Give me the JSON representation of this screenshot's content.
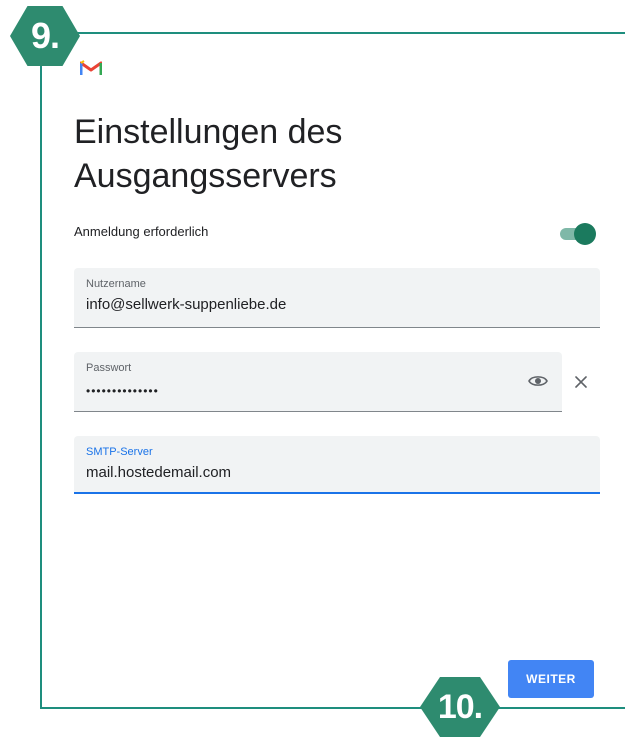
{
  "badges": {
    "step_current": "9.",
    "step_next": "10."
  },
  "app": {
    "logo": "gmail-m-logo"
  },
  "page": {
    "title": "Einstellungen des Ausgangsservers"
  },
  "auth_toggle": {
    "label": "Anmeldung erforderlich",
    "enabled": true
  },
  "fields": {
    "username": {
      "label": "Nutzername",
      "value": "info@sellwerk-suppenliebe.de"
    },
    "password": {
      "label": "Passwort",
      "value": "••••••••••••••"
    },
    "smtp": {
      "label": "SMTP-Server",
      "value": "mail.hostedemail.com"
    }
  },
  "actions": {
    "next_label": "WEITER"
  },
  "colors": {
    "accent": "#1a73e8",
    "badge": "#2e8b6f",
    "toggle": "#1b7a5e",
    "button": "#4285f4"
  }
}
